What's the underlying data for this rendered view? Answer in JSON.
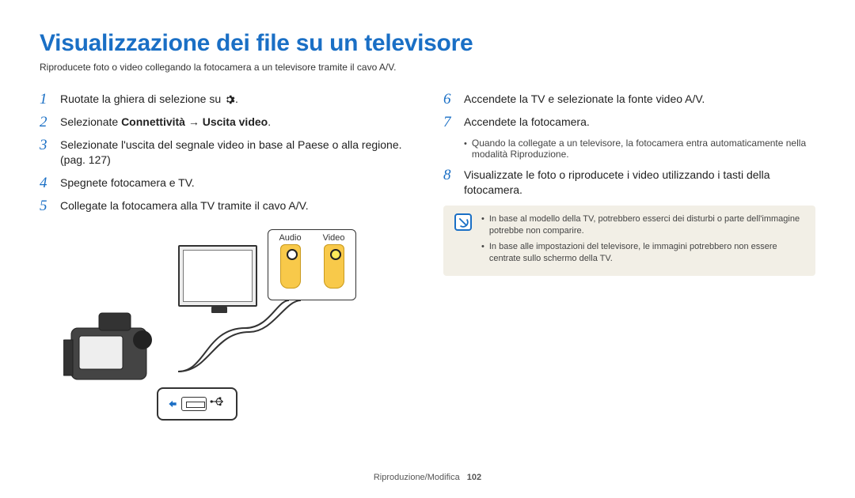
{
  "title": "Visualizzazione dei file su un televisore",
  "subtitle": "Riproducete foto o video collegando la fotocamera a un televisore tramite il cavo A/V.",
  "left_steps": [
    {
      "n": "1",
      "text_pre": "Ruotate la ghiera di selezione su ",
      "text_post": "."
    },
    {
      "n": "2",
      "text_pre": "Selezionate ",
      "bold1": "Connettività",
      "arrow": " → ",
      "bold2": "Uscita video",
      "text_post": "."
    },
    {
      "n": "3",
      "text": "Selezionate l'uscita del segnale video in base al Paese o alla regione. (pag. 127)"
    },
    {
      "n": "4",
      "text": "Spegnete fotocamera e TV."
    },
    {
      "n": "5",
      "text": "Collegate la fotocamera alla TV tramite il cavo A/V."
    }
  ],
  "right_steps": [
    {
      "n": "6",
      "text": "Accendete la TV e selezionate la fonte video A/V."
    },
    {
      "n": "7",
      "text": "Accendete la fotocamera."
    }
  ],
  "right_sub": "Quando la collegate a un televisore, la fotocamera entra automaticamente nella modalità Riproduzione.",
  "right_step8": {
    "n": "8",
    "text": "Visualizzate le foto o riproducete i video utilizzando i tasti della fotocamera."
  },
  "note": [
    "In base al modello della TV, potrebbero esserci dei disturbi o parte dell'immagine potrebbe non comparire.",
    "In base alle impostazioni del televisore, le immagini potrebbero non essere centrate sullo schermo della TV."
  ],
  "av_labels": {
    "audio": "Audio",
    "video": "Video"
  },
  "footer": {
    "section": "Riproduzione/Modifica",
    "page": "102"
  }
}
